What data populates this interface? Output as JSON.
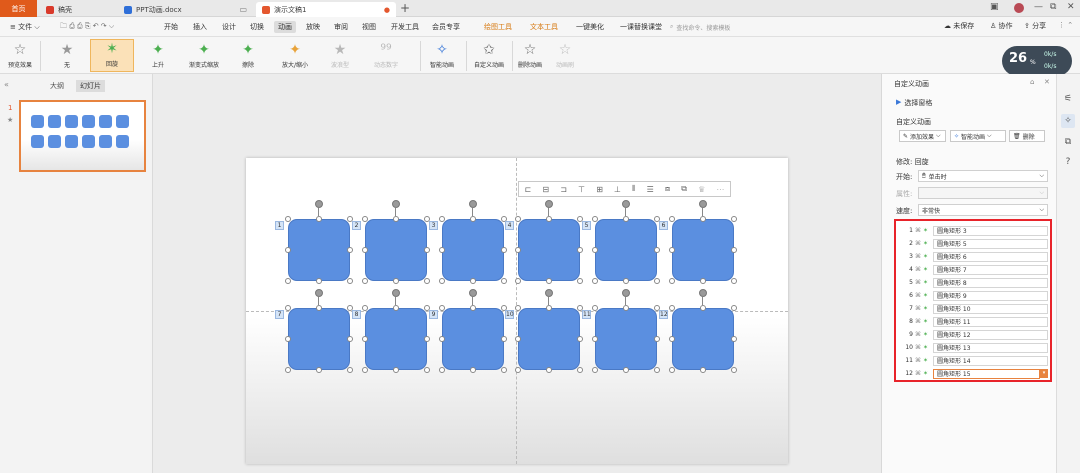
{
  "tabs": {
    "home": "首页",
    "t1": "稿壳",
    "t2": "PPT动画.docx",
    "t3": "演示文稿1"
  },
  "menubar": {
    "file": "文件",
    "items": [
      "开始",
      "插入",
      "设计",
      "切换",
      "动画",
      "放映",
      "审阅",
      "视图",
      "开发工具",
      "会员专享"
    ],
    "orange_items": [
      "绘图工具",
      "文本工具"
    ],
    "extra": [
      "一键美化",
      "一课替换课堂"
    ],
    "search_placeholder": "查找命令、搜索模板",
    "unsaved": "未保存",
    "collab": "协作",
    "share": "分享"
  },
  "ribbon": {
    "preview": "预览效果",
    "effects": [
      "无",
      "回旋",
      "上升",
      "渐变式缩放",
      "擦除",
      "放大/缩小",
      "波浪型",
      "动态数字"
    ],
    "smart": "智能动画",
    "custom": "自定义动画",
    "delete": "删除动画",
    "painter": "动画刷"
  },
  "clock": {
    "value": "26",
    "unit": "%",
    "up": "0k/s",
    "down": "0k/s"
  },
  "leftpanel": {
    "outline": "大纲",
    "slides": "幻灯片",
    "slide_num": "1"
  },
  "slide": {
    "labels": [
      "1",
      "2",
      "3",
      "4",
      "5",
      "6",
      "7",
      "8",
      "9",
      "10",
      "11",
      "12"
    ]
  },
  "panel": {
    "title": "自定义动画",
    "select_pane": "选择窗格",
    "subtitle": "自定义动画",
    "add_effect": "添加效果",
    "smart_anim": "智能动画",
    "delete": "删除",
    "modify": "修改: 回旋",
    "start_label": "开始:",
    "start_value": "单击时",
    "prop_label": "属性:",
    "speed_label": "速度:",
    "speed_value": "非常快"
  },
  "animlist": [
    {
      "n": "1",
      "name": "圆角矩形 3"
    },
    {
      "n": "2",
      "name": "圆角矩形 5"
    },
    {
      "n": "3",
      "name": "圆角矩形 6"
    },
    {
      "n": "4",
      "name": "圆角矩形 7"
    },
    {
      "n": "5",
      "name": "圆角矩形 8"
    },
    {
      "n": "6",
      "name": "圆角矩形 9"
    },
    {
      "n": "7",
      "name": "圆角矩形 10"
    },
    {
      "n": "8",
      "name": "圆角矩形 11"
    },
    {
      "n": "9",
      "name": "圆角矩形 12"
    },
    {
      "n": "10",
      "name": "圆角矩形 13"
    },
    {
      "n": "11",
      "name": "圆角矩形 14"
    },
    {
      "n": "12",
      "name": "圆角矩形 15"
    }
  ]
}
